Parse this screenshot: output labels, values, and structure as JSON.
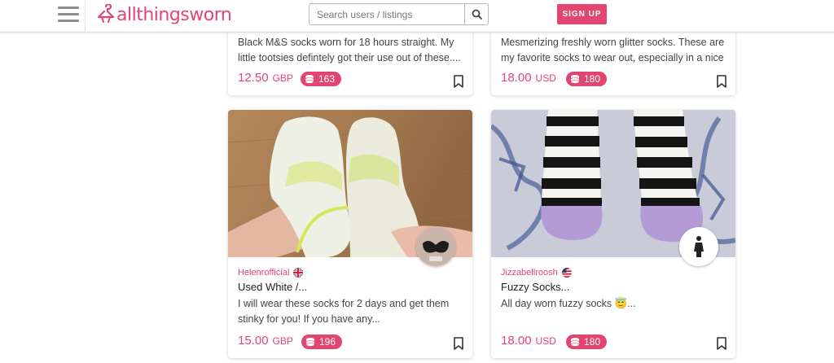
{
  "header": {
    "logo_text": "allthingsworn",
    "search_placeholder": "Search users / listings",
    "signup_label": "SIGN UP",
    "brand_color": "#e2456f"
  },
  "listings": [
    {
      "description": "Black M&S socks worn for 18 hours straight. My little tootsies defintely got their use out of these....",
      "price": "12.50",
      "currency": "GBP",
      "points": "163"
    },
    {
      "description": "Mesmerizing freshly worn glitter socks. These are my favorite socks to wear out, especially in a nice",
      "price": "18.00",
      "currency": "USD",
      "points": "180"
    },
    {
      "seller": "Helenrofficial",
      "flag": "uk-flag",
      "title": "Used White /...",
      "description": "I will wear these socks for 2 days and get them stinky for you! If you have any...",
      "price": "15.00",
      "currency": "GBP",
      "points": "196"
    },
    {
      "seller": "Jizzabellroosh",
      "flag": "us-flag",
      "title": "Fuzzy Socks...",
      "description": "All day worn fuzzy socks 😇...",
      "price": "18.00",
      "currency": "USD",
      "points": "180"
    }
  ]
}
